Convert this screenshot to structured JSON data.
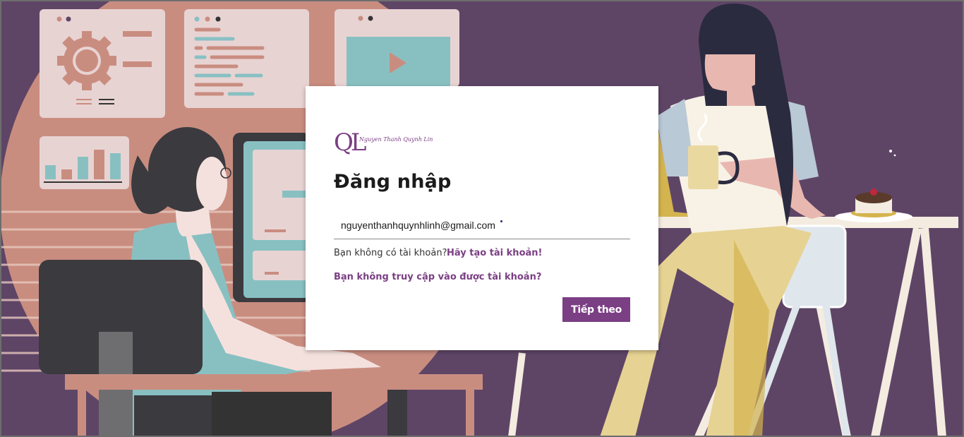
{
  "login": {
    "logo_monogram": "QL",
    "logo_script": "Nguyen Thanh Quynh Linh",
    "title": "Đăng nhập",
    "email_value": "nguyenthanhquynhlinh@gmail.com",
    "no_account_text": "Bạn không có tài khoản?",
    "create_account_link": "Hãy tạo tài khoản!",
    "cannot_access_link": "Bạn không truy cập vào được tài khoản?",
    "next_button": "Tiếp theo"
  },
  "colors": {
    "background": "#5e4566",
    "accent": "#7b3f84",
    "card": "#ffffff",
    "illustration_salmon": "#c98d80",
    "illustration_teal": "#88c0c2",
    "illustration_cream": "#f4ece0",
    "illustration_gold": "#d4b44e"
  }
}
